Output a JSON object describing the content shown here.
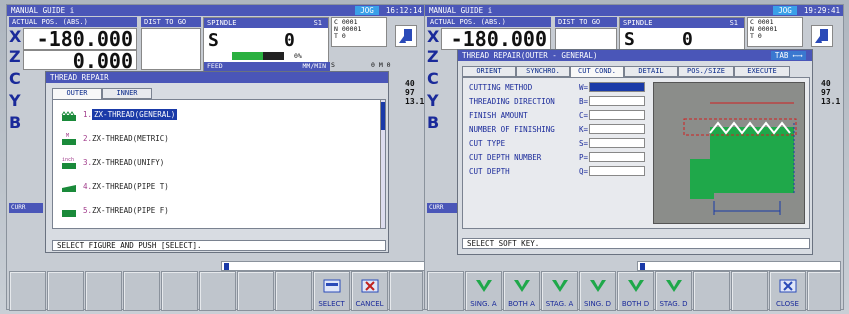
{
  "left": {
    "title": "MANUAL GUIDE i",
    "mode": "JOG",
    "clock": "16:12:14",
    "pos_header": "ACTUAL POS. (ABS.)",
    "dist_header": "DIST TO GO",
    "spindle_header": "SPINDLE",
    "spindle_id": "S1",
    "axes": [
      "X",
      "Z",
      "C",
      "Y",
      "B"
    ],
    "x_value": "-180.000",
    "z_value": "0.000",
    "spindle_value": "0",
    "spindle_load": "0%",
    "feed_label": "FEED",
    "feed_unit": "MM/MIN",
    "info": {
      "c": "C 0001",
      "n": "N 00001",
      "t": "T 0"
    },
    "s_line": "S",
    "m_line": "0 M 0",
    "right_nums": [
      "40",
      "97",
      "13.1"
    ],
    "curr_label": "CURR",
    "dialog": {
      "title": "THREAD REPAIR",
      "tabs": [
        "OUTER",
        "INNER"
      ],
      "items": [
        {
          "num": "1.",
          "label": "ZX-THREAD(GENERAL)",
          "icon": "thread-general-icon"
        },
        {
          "num": "2.",
          "label": "ZX-THREAD(METRIC)",
          "icon": "thread-metric-icon"
        },
        {
          "num": "3.",
          "label": "ZX-THREAD(UNIFY)",
          "icon": "thread-unify-icon"
        },
        {
          "num": "4.",
          "label": "ZX-THREAD(PIPE T)",
          "icon": "thread-pipe-t-icon"
        },
        {
          "num": "5.",
          "label": "ZX-THREAD(PIPE F)",
          "icon": "thread-pipe-f-icon"
        }
      ],
      "status": "SELECT FIGURE AND PUSH [SELECT]."
    },
    "softkeys": [
      "",
      "",
      "",
      "",
      "",
      "",
      "",
      "",
      "SELECT",
      "CANCEL"
    ]
  },
  "right": {
    "title": "MANUAL GUIDE i",
    "mode": "JOG",
    "clock": "19:29:41",
    "pos_header": "ACTUAL POS. (ABS.)",
    "dist_header": "DIST TO GO",
    "spindle_header": "SPINDLE",
    "spindle_id": "S1",
    "axes": [
      "X",
      "Z",
      "C",
      "Y",
      "B"
    ],
    "x_value": "-180.000",
    "spindle_value": "0",
    "info": {
      "c": "C 0001",
      "n": "N 00001",
      "t": "T 0"
    },
    "right_nums": [
      "40",
      "97",
      "13.1"
    ],
    "curr_label": "CURR",
    "dialog": {
      "title": "THREAD REPAIR(OUTER - GENERAL)",
      "tab_hint": "TAB",
      "tabs": [
        "ORIENT",
        "SYNCHRO.",
        "CUT COND.",
        "DETAIL",
        "POS./SIZE",
        "EXECUTE"
      ],
      "fields": [
        {
          "label": "CUTTING METHOD",
          "prefix": "W="
        },
        {
          "label": "THREADING DIRECTION",
          "prefix": "B="
        },
        {
          "label": "FINISH AMOUNT",
          "prefix": "C="
        },
        {
          "label": "NUMBER OF FINISHING",
          "prefix": "K="
        },
        {
          "label": "CUT TYPE",
          "prefix": "S="
        },
        {
          "label": "CUT DEPTH NUMBER",
          "prefix": "P="
        },
        {
          "label": "CUT DEPTH",
          "prefix": "Q="
        }
      ],
      "status": "SELECT SOFT KEY."
    },
    "softkeys": [
      "SING. A",
      "BOTH A",
      "STAG. A",
      "SING. D",
      "BOTH D",
      "STAG. D",
      "",
      "",
      "",
      "CLOSE"
    ]
  }
}
